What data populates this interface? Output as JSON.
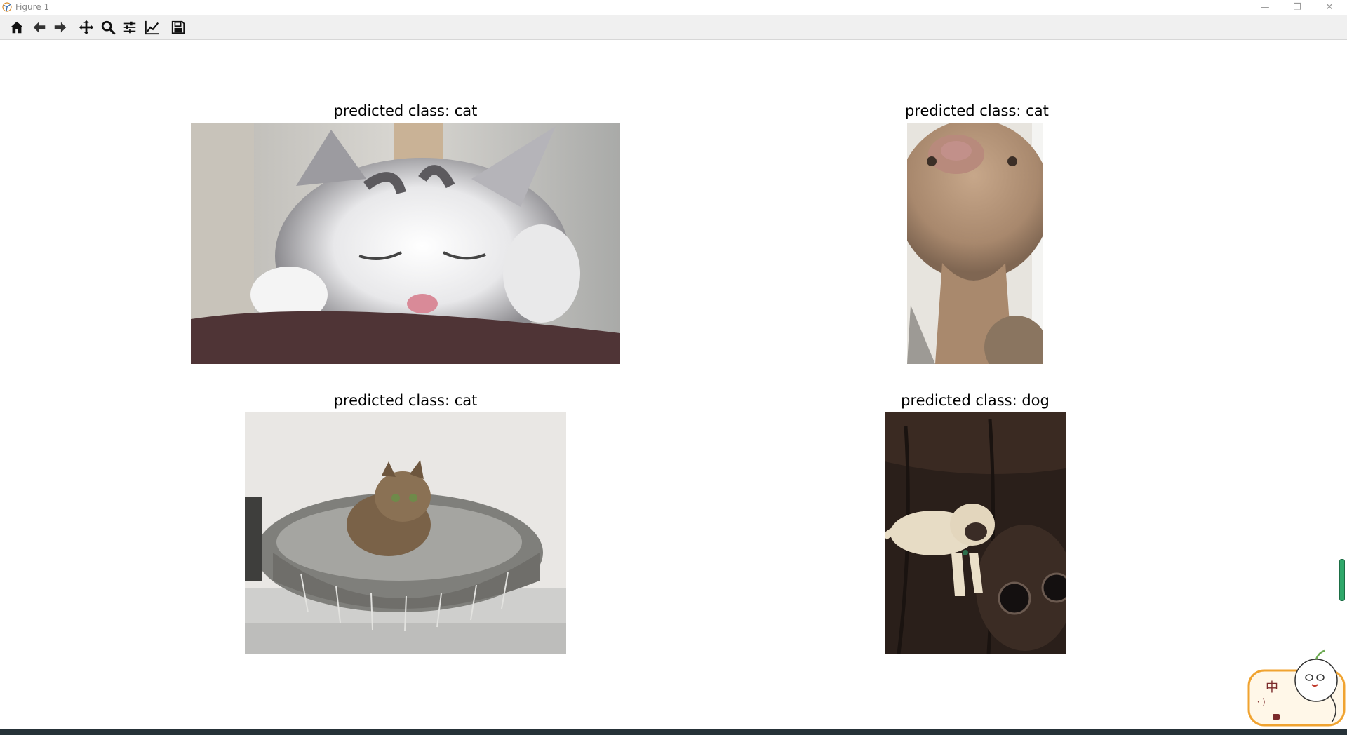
{
  "window": {
    "title": "Figure 1",
    "controls": [
      "minimize",
      "maximize",
      "close"
    ]
  },
  "toolbar": {
    "buttons": [
      {
        "name": "home",
        "icon": "home-icon"
      },
      {
        "name": "back",
        "icon": "arrow-left-icon"
      },
      {
        "name": "forward",
        "icon": "arrow-right-icon"
      },
      {
        "name": "pan",
        "icon": "move-icon"
      },
      {
        "name": "zoom",
        "icon": "magnifier-icon"
      },
      {
        "name": "configure-subplots",
        "icon": "sliders-icon"
      },
      {
        "name": "edit-axis",
        "icon": "line-chart-icon"
      },
      {
        "name": "save",
        "icon": "floppy-disk-icon"
      }
    ]
  },
  "subplots": [
    {
      "title": "predicted class: cat",
      "image": "sleeping gray-white kitten"
    },
    {
      "title": "predicted class: cat",
      "image": "tabby cat looking down at camera"
    },
    {
      "title": "predicted class: cat",
      "image": "tabby cat in gray pet bed"
    },
    {
      "title": "predicted class: dog",
      "image": "pug on dark leather sofa"
    }
  ],
  "ime": {
    "char_top": "中",
    "char_side": "ㆍ)"
  },
  "colors": {
    "toolbar_bg": "#f0f0f0",
    "canvas_bg": "#ffffff",
    "taskbar": "#263238"
  }
}
